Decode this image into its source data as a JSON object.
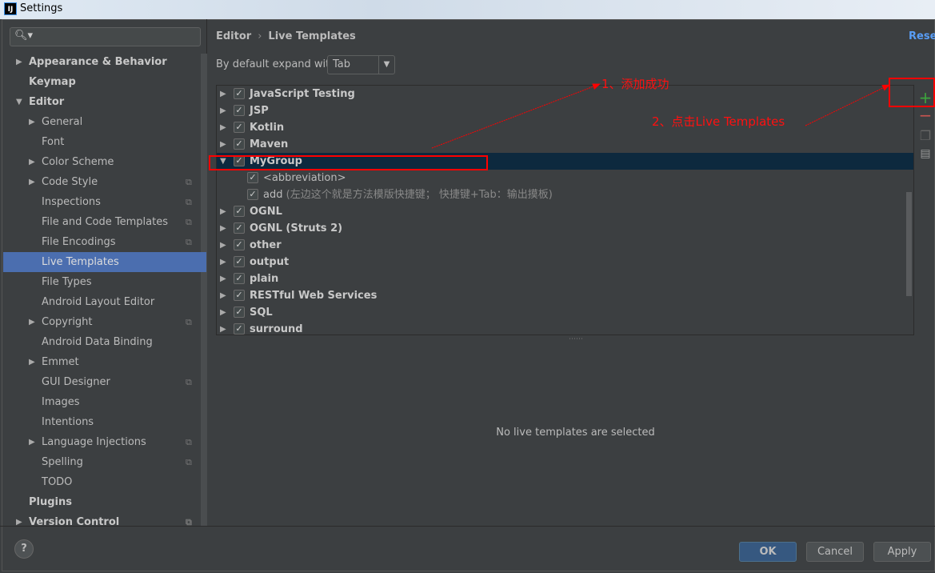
{
  "window": {
    "title": "Settings",
    "logo": "IJ"
  },
  "sidebar": {
    "search_icon": "search-icon",
    "items": [
      {
        "label": "Appearance & Behavior",
        "level": 0,
        "bold": true,
        "arrow": "right"
      },
      {
        "label": "Keymap",
        "level": 0,
        "bold": true
      },
      {
        "label": "Editor",
        "level": 0,
        "bold": true,
        "arrow": "down"
      },
      {
        "label": "General",
        "level": 1,
        "arrow": "right"
      },
      {
        "label": "Font",
        "level": 1
      },
      {
        "label": "Color Scheme",
        "level": 1,
        "arrow": "right"
      },
      {
        "label": "Code Style",
        "level": 1,
        "arrow": "right",
        "project_icon": true
      },
      {
        "label": "Inspections",
        "level": 1,
        "project_icon": true
      },
      {
        "label": "File and Code Templates",
        "level": 1,
        "project_icon": true
      },
      {
        "label": "File Encodings",
        "level": 1,
        "project_icon": true
      },
      {
        "label": "Live Templates",
        "level": 1,
        "selected": true
      },
      {
        "label": "File Types",
        "level": 1
      },
      {
        "label": "Android Layout Editor",
        "level": 1
      },
      {
        "label": "Copyright",
        "level": 1,
        "arrow": "right",
        "project_icon": true
      },
      {
        "label": "Android Data Binding",
        "level": 1
      },
      {
        "label": "Emmet",
        "level": 1,
        "arrow": "right"
      },
      {
        "label": "GUI Designer",
        "level": 1,
        "project_icon": true
      },
      {
        "label": "Images",
        "level": 1
      },
      {
        "label": "Intentions",
        "level": 1
      },
      {
        "label": "Language Injections",
        "level": 1,
        "arrow": "right",
        "project_icon": true
      },
      {
        "label": "Spelling",
        "level": 1,
        "project_icon": true
      },
      {
        "label": "TODO",
        "level": 1
      },
      {
        "label": "Plugins",
        "level": 0,
        "bold": true
      },
      {
        "label": "Version Control",
        "level": 0,
        "bold": true,
        "arrow": "right",
        "project_icon": true
      }
    ]
  },
  "main": {
    "breadcrumb": [
      "Editor",
      "Live Templates"
    ],
    "reset_label": "Reset",
    "expand_label": "By default expand with",
    "expand_value": "Tab",
    "tree": [
      {
        "label": "JavaScript Testing",
        "checked": true,
        "group": true,
        "expanded": false
      },
      {
        "label": "JSP",
        "checked": true,
        "group": true,
        "expanded": false
      },
      {
        "label": "Kotlin",
        "checked": true,
        "group": true,
        "expanded": false
      },
      {
        "label": "Maven",
        "checked": true,
        "group": true,
        "expanded": false
      },
      {
        "label": "MyGroup",
        "checked": true,
        "group": true,
        "expanded": true,
        "selected": true
      },
      {
        "label": "<abbreviation>",
        "checked": true,
        "group": false
      },
      {
        "label": "add",
        "description": "(左边这个就是方法模版快捷键； 快捷键+Tab：输出摸板)",
        "checked": true,
        "group": false
      },
      {
        "label": "OGNL",
        "checked": true,
        "group": true,
        "expanded": false
      },
      {
        "label": "OGNL (Struts 2)",
        "checked": true,
        "group": true,
        "expanded": false
      },
      {
        "label": "other",
        "checked": true,
        "group": true,
        "expanded": false
      },
      {
        "label": "output",
        "checked": true,
        "group": true,
        "expanded": false
      },
      {
        "label": "plain",
        "checked": true,
        "group": true,
        "expanded": false
      },
      {
        "label": "RESTful Web Services",
        "checked": true,
        "group": true,
        "expanded": false
      },
      {
        "label": "SQL",
        "checked": true,
        "group": true,
        "expanded": false
      },
      {
        "label": "surround",
        "checked": true,
        "group": true,
        "expanded": false
      }
    ],
    "tools": [
      "add-icon",
      "remove-icon",
      "copy-icon",
      "change-context-icon"
    ],
    "empty_message": "No live templates are selected"
  },
  "footer": {
    "help": "?",
    "ok": "OK",
    "cancel": "Cancel",
    "apply": "Apply"
  },
  "annotations": {
    "note1": "1、添加成功",
    "note2": "2、点击Live Templates",
    "color": "#ff0000"
  },
  "colors": {
    "selection": "#4b6eaf",
    "tree_selection": "#0d293e",
    "link": "#589df6",
    "add": "#3da53d",
    "remove": "#c75450"
  }
}
